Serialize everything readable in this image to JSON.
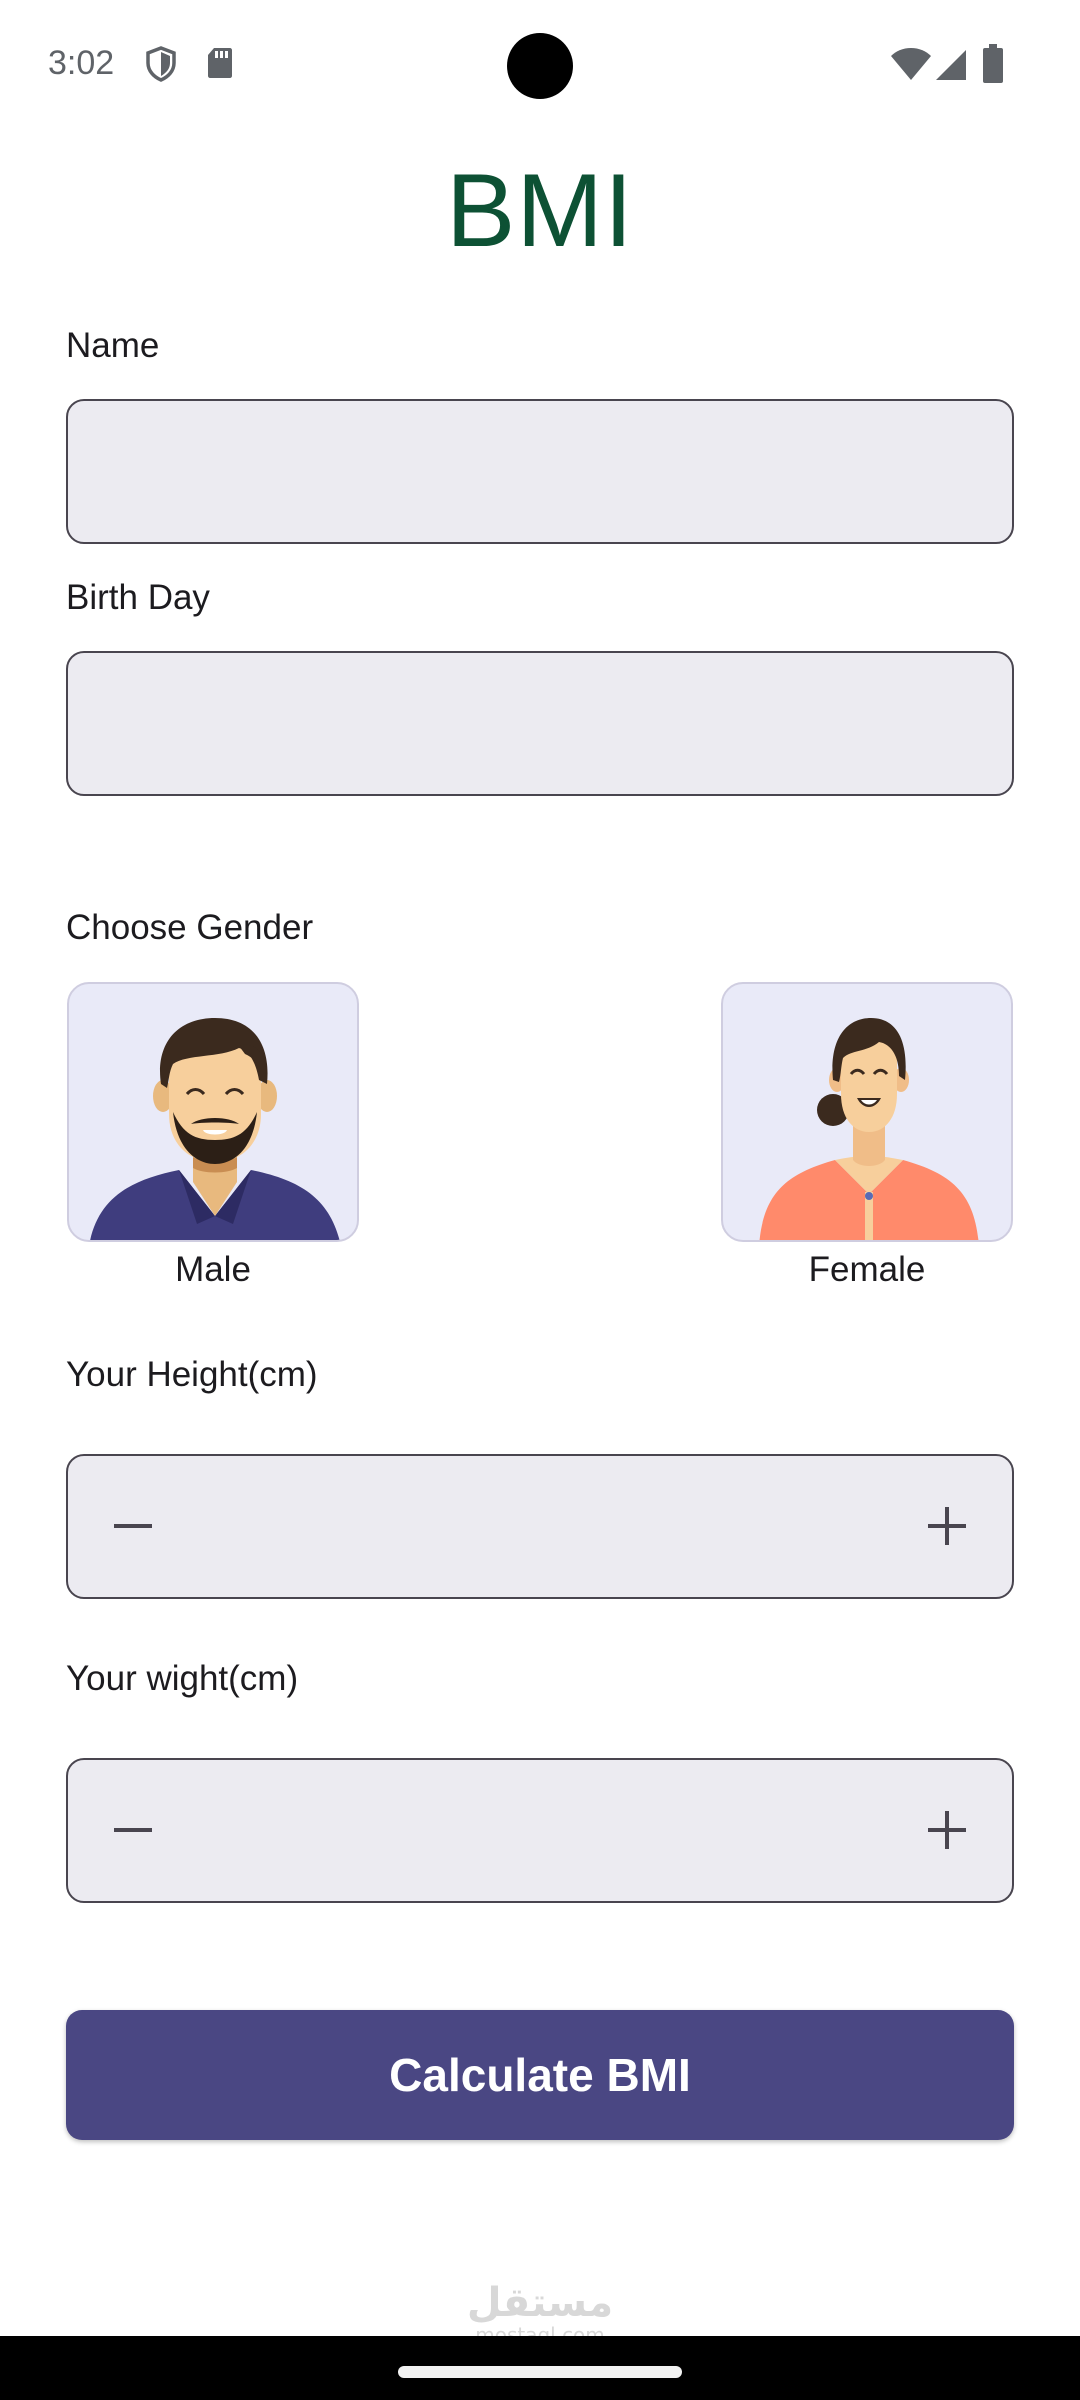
{
  "status_bar": {
    "time": "3:02",
    "left_icons": [
      "shield-icon",
      "sd-card-icon"
    ],
    "right_icons": [
      "wifi-icon",
      "cellular-signal-icon",
      "battery-icon"
    ]
  },
  "header": {
    "title": "BMI",
    "title_color": "#0d5134"
  },
  "form": {
    "name": {
      "label": "Name",
      "value": "",
      "placeholder": ""
    },
    "birthday": {
      "label": "Birth Day",
      "value": "",
      "placeholder": ""
    },
    "gender": {
      "label": "Choose Gender",
      "options": [
        {
          "label": "Male",
          "icon": "male-avatar-icon"
        },
        {
          "label": "Female",
          "icon": "female-avatar-icon"
        }
      ]
    },
    "height": {
      "label": "Your Height(cm)",
      "value": "",
      "decrement_icon": "minus-icon",
      "increment_icon": "plus-icon"
    },
    "weight": {
      "label": "Your wight(cm)",
      "value": "",
      "decrement_icon": "minus-icon",
      "increment_icon": "plus-icon"
    }
  },
  "actions": {
    "calculate_label": "Calculate BMI",
    "button_color": "#4a4783"
  },
  "watermark": {
    "main": "مستقل",
    "sub": "mostaql.com"
  },
  "colors": {
    "field_background": "#ecebf1",
    "field_border": "#49454f",
    "card_background": "#e9eaf8"
  }
}
